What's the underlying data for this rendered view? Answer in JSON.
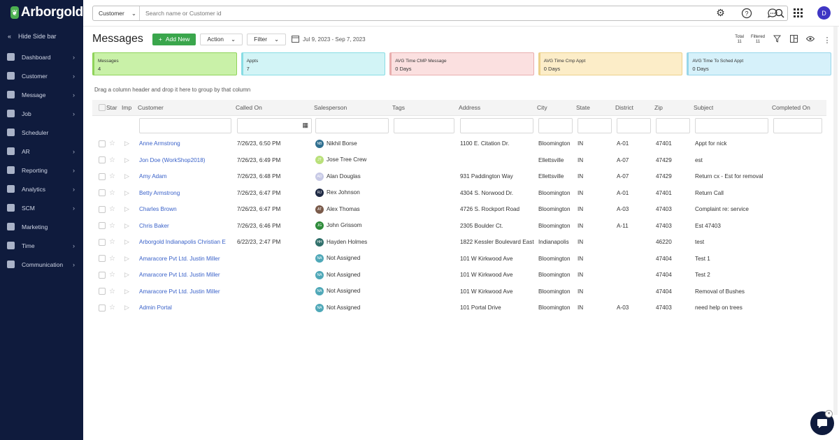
{
  "app": {
    "name": "Arborgold"
  },
  "sidebar": {
    "hide_label": "Hide Side bar",
    "items": [
      {
        "label": "Dashboard",
        "has_children": true
      },
      {
        "label": "Customer",
        "has_children": true
      },
      {
        "label": "Message",
        "has_children": true
      },
      {
        "label": "Job",
        "has_children": true
      },
      {
        "label": "Scheduler",
        "has_children": false
      },
      {
        "label": "AR",
        "has_children": true
      },
      {
        "label": "Reporting",
        "has_children": true
      },
      {
        "label": "Analytics",
        "has_children": true
      },
      {
        "label": "SCM",
        "has_children": true
      },
      {
        "label": "Marketing",
        "has_children": false
      },
      {
        "label": "Time",
        "has_children": true
      },
      {
        "label": "Communication",
        "has_children": true
      }
    ]
  },
  "topbar": {
    "search_scope": "Customer",
    "search_placeholder": "Search name or Customer id",
    "avatar_initial": "D"
  },
  "header": {
    "title": "Messages",
    "add_new": "Add New",
    "action": "Action",
    "filter": "Filter",
    "date_range": "Jul 9, 2023 - Sep 7, 2023",
    "total_label": "Total",
    "total_value": "11",
    "filtered_label": "Filtered",
    "filtered_value": "11"
  },
  "cards": [
    {
      "label": "Messages",
      "value": "4",
      "bg": "#c9f1a8",
      "border": "#8fd35a"
    },
    {
      "label": "Appts",
      "value": "7",
      "bg": "#d2f4f6",
      "border": "#88dde4"
    },
    {
      "label": "AVG Time CMP Message",
      "value": "0 Days",
      "bg": "#fbe0e0",
      "border": "#e9aeae"
    },
    {
      "label": "AVG Time Cmp Appt",
      "value": "0 Days",
      "bg": "#fcedc8",
      "border": "#ecd18a"
    },
    {
      "label": "AVG Time To Sched Appt",
      "value": "0 Days",
      "bg": "#d6f1fa",
      "border": "#98d6ea"
    }
  ],
  "group_hint": "Drag a column header and drop it here to group by that column",
  "columns": [
    "Star",
    "Imp",
    "Customer",
    "Called On",
    "Salesperson",
    "Tags",
    "Address",
    "City",
    "State",
    "District",
    "Zip",
    "Subject",
    "Completed On"
  ],
  "rows": [
    {
      "customer": "Anne Armstrong",
      "called_on": "7/26/23, 6:50 PM",
      "sp_initials": "NB",
      "sp_color": "#2f6f8f",
      "salesperson": "Nikhil Borse",
      "tags": "",
      "address": "1100 E. Citation Dr.",
      "city": "Bloomington",
      "state": "IN",
      "district": "A-01",
      "zip": "47401",
      "subject": "Appt for nick"
    },
    {
      "customer": "Jon Doe (WorkShop2018)",
      "called_on": "7/26/23, 6:49 PM",
      "sp_initials": "JT",
      "sp_color": "#b9e07a",
      "salesperson": "Jose Tree Crew",
      "tags": "",
      "address": "",
      "city": "Ellettsville",
      "state": "IN",
      "district": "A-07",
      "zip": "47429",
      "subject": "est"
    },
    {
      "customer": "Amy Adam",
      "called_on": "7/26/23, 6:48 PM",
      "sp_initials": "AD",
      "sp_color": "#c7c9e6",
      "salesperson": "Alan Douglas",
      "tags": "",
      "address": "931 Paddington Way",
      "city": "Ellettsville",
      "state": "IN",
      "district": "A-07",
      "zip": "47429",
      "subject": "Return cx - Est for removal"
    },
    {
      "customer": "Betty Armstrong",
      "called_on": "7/26/23, 6:47 PM",
      "sp_initials": "RJ",
      "sp_color": "#1f2a44",
      "salesperson": "Rex Johnson",
      "tags": "",
      "address": "4304 S. Norwood Dr.",
      "city": "Bloomington",
      "state": "IN",
      "district": "A-01",
      "zip": "47401",
      "subject": "Return Call"
    },
    {
      "customer": "Charles Brown",
      "called_on": "7/26/23, 6:47 PM",
      "sp_initials": "AT",
      "sp_color": "#7a5a4a",
      "salesperson": "Alex Thomas",
      "tags": "",
      "address": "4726 S. Rockport Road",
      "city": "Bloomington",
      "state": "IN",
      "district": "A-03",
      "zip": "47403",
      "subject": "Complaint re: service"
    },
    {
      "customer": "Chris Baker",
      "called_on": "7/26/23, 6:46 PM",
      "sp_initials": "JG",
      "sp_color": "#2e8b3a",
      "salesperson": "John Grissom",
      "tags": "",
      "address": "2305 Boulder Ct.",
      "city": "Bloomington",
      "state": "IN",
      "district": "A-11",
      "zip": "47403",
      "subject": "Est 47403"
    },
    {
      "customer": "Arborgold Indianapolis Christian E",
      "called_on": "6/22/23, 2:47 PM",
      "sp_initials": "HH",
      "sp_color": "#2f6f6a",
      "salesperson": "Hayden Holmes",
      "tags": "",
      "address": "1822 Kessler Boulevard East",
      "city": "Indianapolis",
      "state": "IN",
      "district": "",
      "zip": "46220",
      "subject": "test"
    },
    {
      "customer": "Amaracore Pvt Ltd. Justin Miller",
      "called_on": "",
      "sp_initials": "NA",
      "sp_color": "#4fa8b8",
      "salesperson": "Not Assigned",
      "tags": "",
      "address": "101 W Kirkwood Ave",
      "city": "Bloomington",
      "state": "IN",
      "district": "",
      "zip": "47404",
      "subject": "Test 1"
    },
    {
      "customer": "Amaracore Pvt Ltd. Justin Miller",
      "called_on": "",
      "sp_initials": "NA",
      "sp_color": "#4fa8b8",
      "salesperson": "Not Assigned",
      "tags": "",
      "address": "101 W Kirkwood Ave",
      "city": "Bloomington",
      "state": "IN",
      "district": "",
      "zip": "47404",
      "subject": "Test 2"
    },
    {
      "customer": "Amaracore Pvt Ltd. Justin Miller",
      "called_on": "",
      "sp_initials": "NA",
      "sp_color": "#4fa8b8",
      "salesperson": "Not Assigned",
      "tags": "",
      "address": "101 W Kirkwood Ave",
      "city": "Bloomington",
      "state": "IN",
      "district": "",
      "zip": "47404",
      "subject": "Removal of Bushes"
    },
    {
      "customer": "Admin Portal",
      "called_on": "",
      "sp_initials": "NA",
      "sp_color": "#4fa8b8",
      "salesperson": "Not Assigned",
      "tags": "",
      "address": "101 Portal Drive",
      "city": "Bloomington",
      "state": "IN",
      "district": "A-03",
      "zip": "47403",
      "subject": "need help on trees"
    }
  ]
}
